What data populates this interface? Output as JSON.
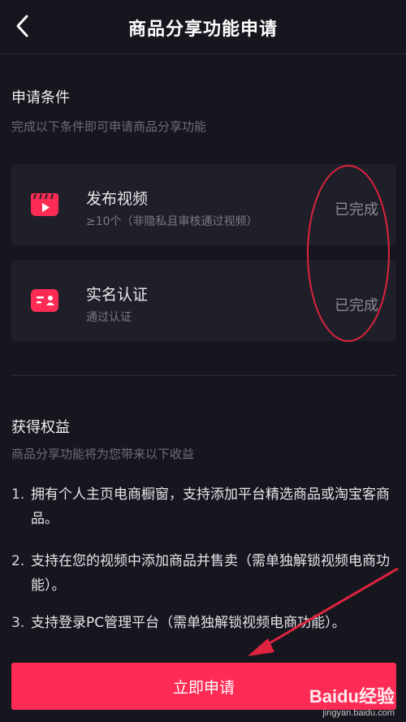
{
  "header": {
    "title": "商品分享功能申请"
  },
  "conditions": {
    "title": "申请条件",
    "subtitle": "完成以下条件即可申请商品分享功能",
    "items": [
      {
        "icon": "video-clapper-icon",
        "title": "发布视频",
        "desc": "≥10个（非隐私且审核通过视频）",
        "status": "已完成"
      },
      {
        "icon": "id-card-icon",
        "title": "实名认证",
        "desc": "通过认证",
        "status": "已完成"
      }
    ]
  },
  "benefits": {
    "title": "获得权益",
    "subtitle": "商品分享功能将为您带来以下收益",
    "items": [
      {
        "num": "1.",
        "text": "拥有个人主页电商橱窗，支持添加平台精选商品或淘宝客商品。"
      },
      {
        "num": "2.",
        "text": "支持在您的视频中添加商品并售卖（需单独解锁视频电商功能）。"
      },
      {
        "num": "3.",
        "text": "支持登录PC管理平台（需单独解锁视频电商功能）。"
      }
    ]
  },
  "apply_button": {
    "label": "立即申请"
  },
  "watermark": {
    "main": "Baidu经验",
    "url": "jingyan.baidu.com"
  },
  "colors": {
    "accent": "#fe2c55",
    "background": "#16161f",
    "card": "#1f1f29",
    "annotation": "#e0233e"
  }
}
